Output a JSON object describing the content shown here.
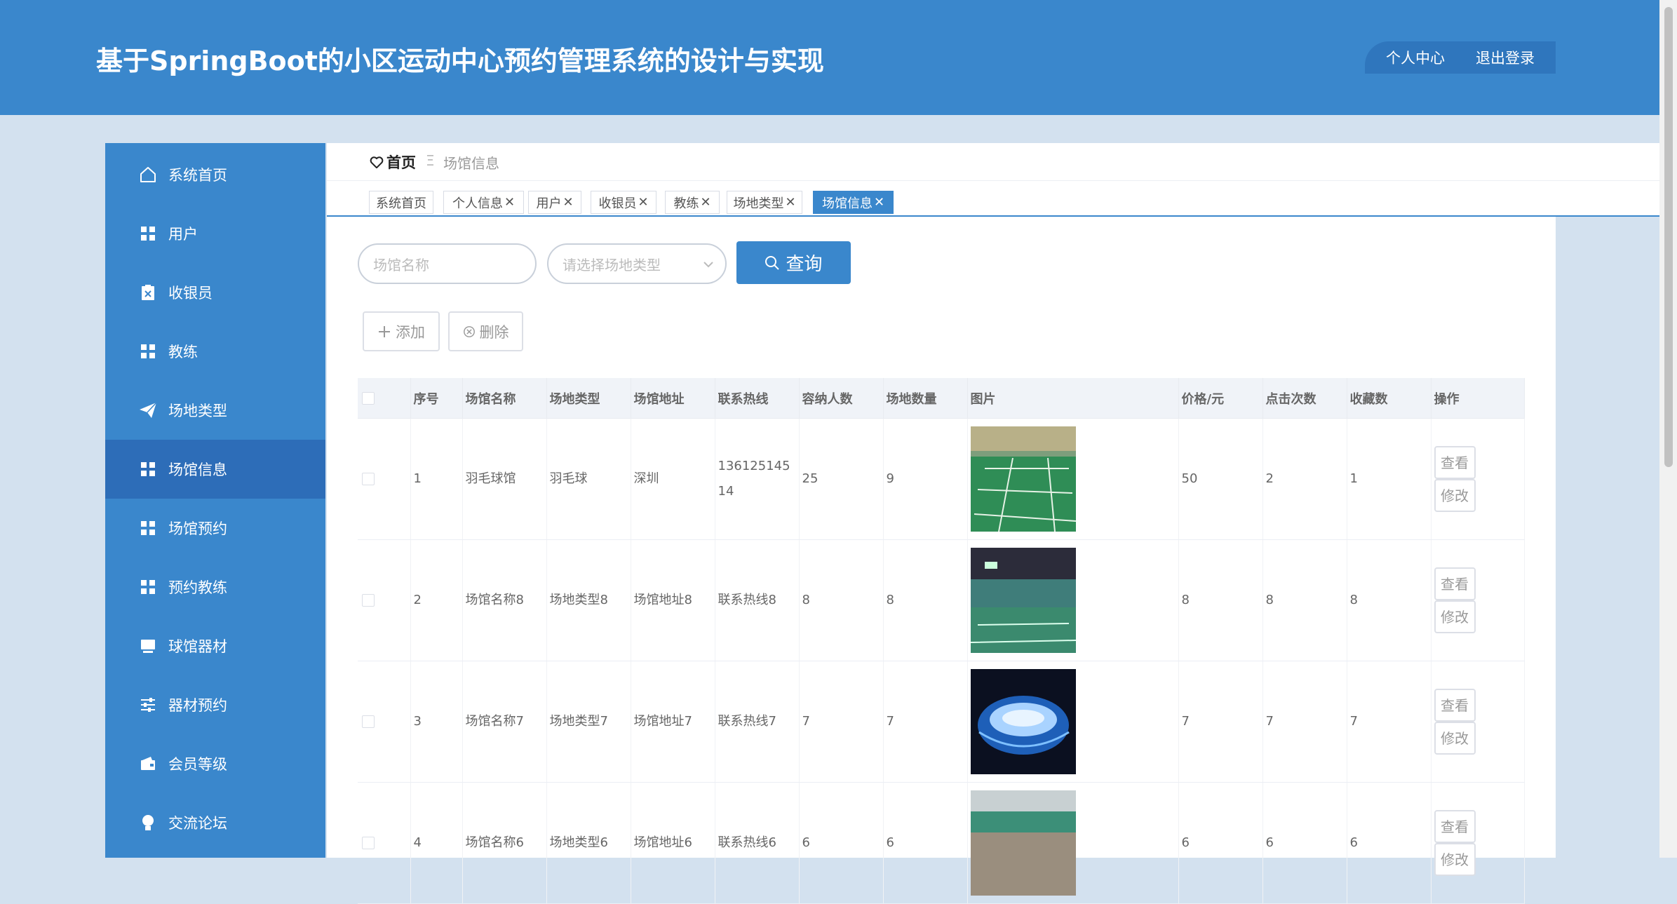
{
  "header": {
    "title": "基于SpringBoot的小区运动中心预约管理系统的设计与实现",
    "personal_center": "个人中心",
    "logout": "退出登录"
  },
  "sidebar": {
    "items": [
      {
        "label": "系统首页",
        "icon": "home-icon"
      },
      {
        "label": "用户",
        "icon": "grid-icon"
      },
      {
        "label": "收银员",
        "icon": "clipboard-icon"
      },
      {
        "label": "教练",
        "icon": "grid-icon"
      },
      {
        "label": "场地类型",
        "icon": "paper-plane-icon"
      },
      {
        "label": "场馆信息",
        "icon": "grid-icon"
      },
      {
        "label": "场馆预约",
        "icon": "grid-icon"
      },
      {
        "label": "预约教练",
        "icon": "grid-icon"
      },
      {
        "label": "球馆器材",
        "icon": "monitor-icon"
      },
      {
        "label": "器材预约",
        "icon": "sliders-icon"
      },
      {
        "label": "会员等级",
        "icon": "wallet-icon"
      },
      {
        "label": "交流论坛",
        "icon": "bulb-icon"
      }
    ],
    "active_index": 5
  },
  "breadcrumb": {
    "home": "首页",
    "separator": "Ξ",
    "current": "场馆信息"
  },
  "tags": [
    {
      "label": "系统首页",
      "closable": false
    },
    {
      "label": "个人信息",
      "closable": true
    },
    {
      "label": "用户",
      "closable": true
    },
    {
      "label": "收银员",
      "closable": true
    },
    {
      "label": "教练",
      "closable": true
    },
    {
      "label": "场地类型",
      "closable": true
    },
    {
      "label": "场馆信息",
      "closable": true,
      "active": true
    }
  ],
  "search": {
    "name_placeholder": "场馆名称",
    "type_placeholder": "请选择场地类型",
    "query_label": "查询"
  },
  "toolbar": {
    "add_label": "添加",
    "delete_label": "删除"
  },
  "table": {
    "columns": [
      "序号",
      "场馆名称",
      "场地类型",
      "场馆地址",
      "联系热线",
      "容纳人数",
      "场地数量",
      "图片",
      "价格/元",
      "点击次数",
      "收藏数",
      "操作"
    ],
    "view_label": "查看",
    "edit_label": "修改",
    "rows": [
      {
        "index": "1",
        "name": "羽毛球馆",
        "type": "羽毛球",
        "address": "深圳",
        "hotline": "13612514514",
        "capacity": "25",
        "courts": "9",
        "image": "green-badminton-court",
        "price": "50",
        "clicks": "2",
        "favorites": "1"
      },
      {
        "index": "2",
        "name": "场馆名称8",
        "type": "场地类型8",
        "address": "场馆地址8",
        "hotline": "联系热线8",
        "capacity": "8",
        "courts": "8",
        "image": "indoor-arena-seats",
        "price": "8",
        "clicks": "8",
        "favorites": "8"
      },
      {
        "index": "3",
        "name": "场馆名称7",
        "type": "场地类型7",
        "address": "场馆地址7",
        "hotline": "联系热线7",
        "capacity": "7",
        "courts": "7",
        "image": "night-stadium-blue",
        "price": "7",
        "clicks": "7",
        "favorites": "7"
      },
      {
        "index": "4",
        "name": "场馆名称6",
        "type": "场地类型6",
        "address": "场馆地址6",
        "hotline": "联系热线6",
        "capacity": "6",
        "courts": "6",
        "image": "gym-hall",
        "price": "6",
        "clicks": "6",
        "favorites": "6"
      }
    ]
  },
  "colors": {
    "primary": "#3a87cc",
    "primary_dark": "#2d6db8",
    "page_bg": "#d3e1ef"
  }
}
